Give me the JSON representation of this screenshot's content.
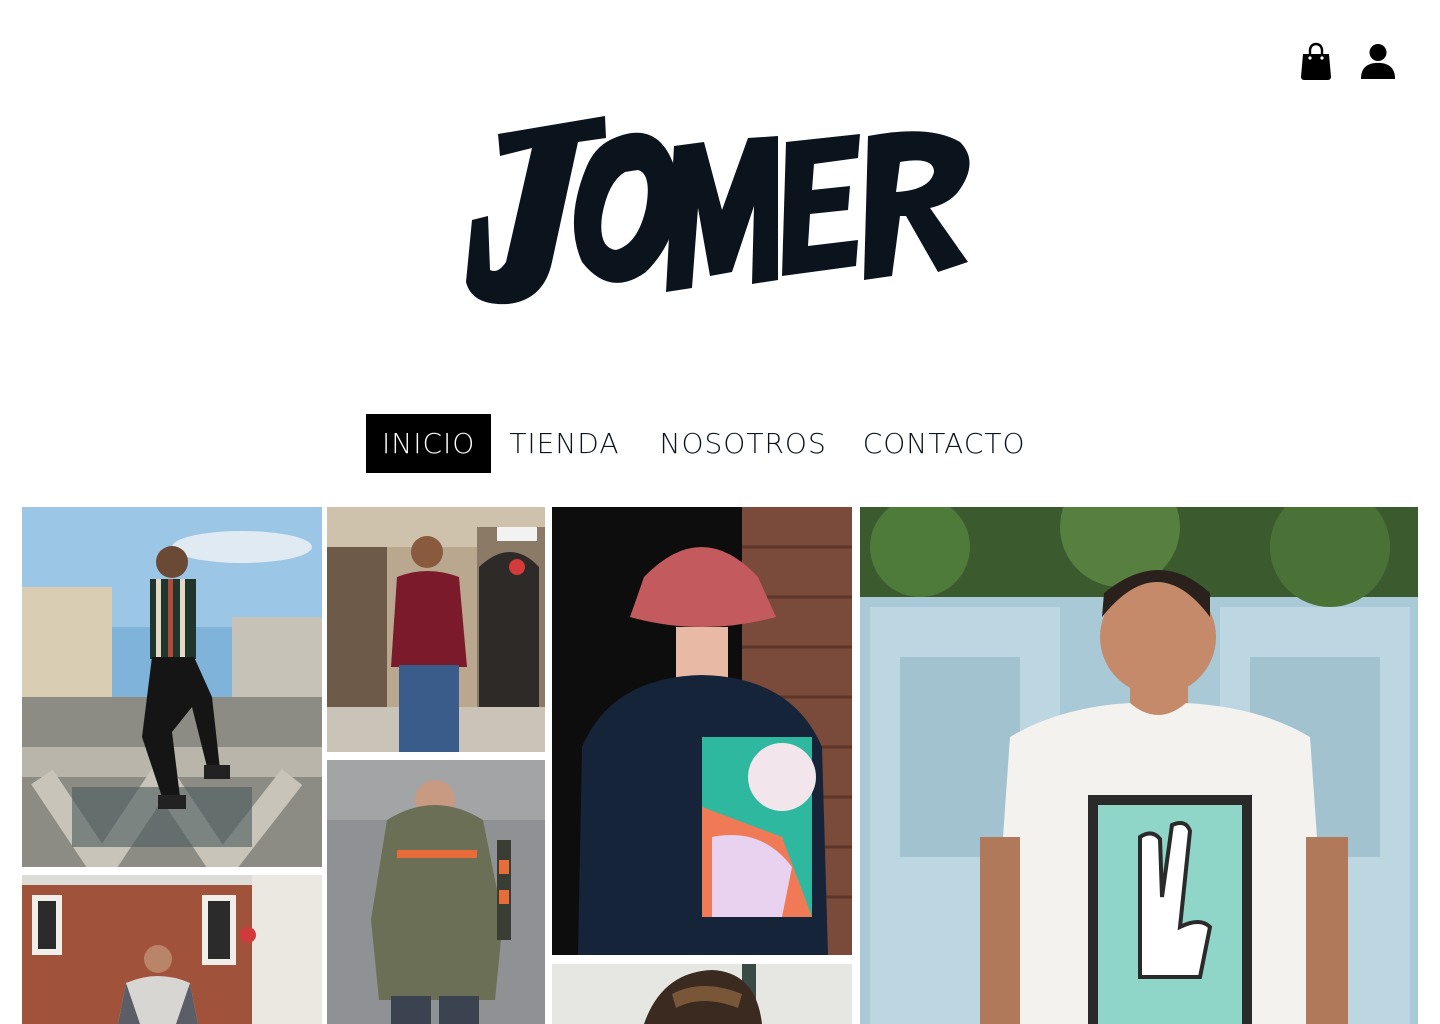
{
  "brand": {
    "name": "JOMER"
  },
  "header": {
    "cart_icon": "shopping-bag-icon",
    "account_icon": "user-icon"
  },
  "nav": {
    "items": [
      {
        "label": "INICIO",
        "active": true
      },
      {
        "label": "TIENDA",
        "active": false
      },
      {
        "label": "NOSOTROS",
        "active": false
      },
      {
        "label": "CONTACTO",
        "active": false
      }
    ]
  },
  "gallery": {
    "photos": [
      "man in striped shirt sitting on a bridge",
      "man in burgundy sweatshirt on street",
      "back view of man in bucket hat and graphic t-shirt",
      "man in white peace-sign t-shirt in front of blue doors",
      "man in olive hoodie against grey wall",
      "man in plaid shirt in front of brick buildings",
      "man with wavy hair"
    ]
  },
  "colors": {
    "ink": "#0b141c",
    "active_bg": "#000000",
    "active_text": "#ffffff"
  }
}
